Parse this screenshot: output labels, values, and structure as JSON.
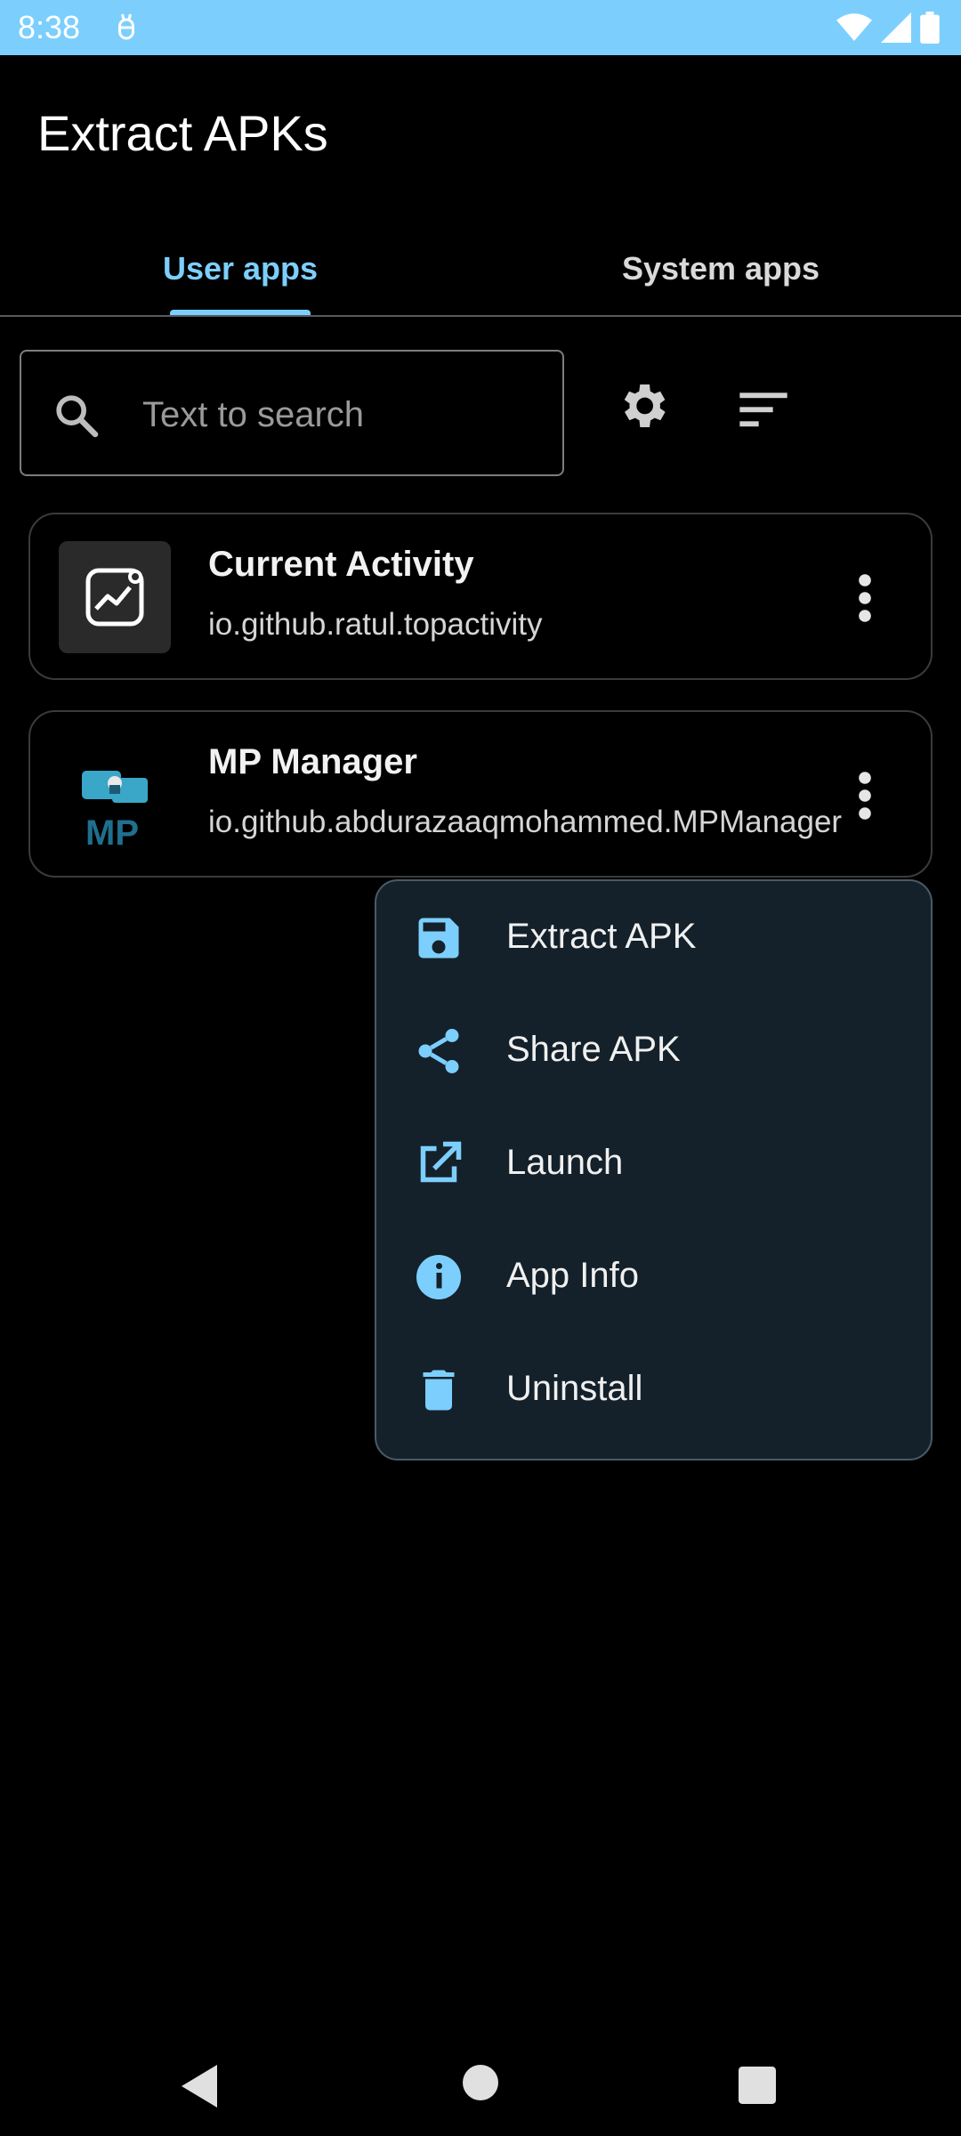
{
  "status_bar": {
    "time": "8:38"
  },
  "header": {
    "title": "Extract APKs"
  },
  "tabs": [
    {
      "label": "User apps",
      "selected": true
    },
    {
      "label": "System apps",
      "selected": false
    }
  ],
  "search": {
    "placeholder": "Text to search",
    "value": ""
  },
  "toolbar": {
    "settings_icon": "gear-icon",
    "sort_icon": "sort-icon"
  },
  "apps": [
    {
      "name": "Current Activity",
      "package": "io.github.ratul.topactivity",
      "icon": "activity-chart-icon"
    },
    {
      "name": "MP Manager",
      "package": "io.github.abdurazaaqmohammed.MPManager",
      "icon_text": "MP"
    }
  ],
  "context_menu": {
    "items": [
      {
        "label": "Extract APK",
        "icon": "save-icon"
      },
      {
        "label": "Share APK",
        "icon": "share-icon"
      },
      {
        "label": "Launch",
        "icon": "open-external-icon"
      },
      {
        "label": "App Info",
        "icon": "info-icon"
      },
      {
        "label": "Uninstall",
        "icon": "trash-icon"
      }
    ]
  },
  "colors": {
    "accent": "#7ccffc",
    "background": "#000000",
    "menu_background": "#14212a",
    "status_bar": "#7ccffc"
  }
}
